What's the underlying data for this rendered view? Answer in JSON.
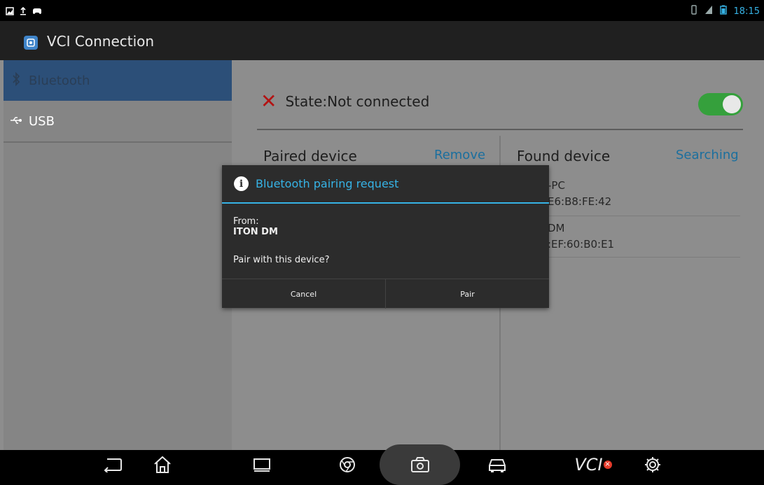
{
  "status_bar": {
    "time": "18:15",
    "left_icons": [
      "image-icon",
      "upload-icon",
      "game-controller-icon"
    ],
    "right_icons": [
      "vibrate-icon",
      "signal-icon",
      "battery-icon"
    ]
  },
  "app_bar": {
    "icon": "app-icon",
    "title": "VCI Connection"
  },
  "sidebar": {
    "items": [
      {
        "icon": "bluetooth-icon",
        "label": "Bluetooth",
        "selected": true
      },
      {
        "icon": "usb-icon",
        "label": "USB",
        "selected": false
      }
    ]
  },
  "content": {
    "state_icon": "close-icon",
    "state_text": "State:Not connected",
    "toggle_on": true,
    "paired_title": "Paired device",
    "paired_action": "Remove",
    "found_title": "Found device",
    "found_action": "Searching",
    "found_devices": [
      {
        "name": "-PC",
        "address": "E6:B8:FE:42"
      },
      {
        "name": "DM",
        "address": ":EF:60:B0:E1"
      }
    ]
  },
  "dialog": {
    "title": "Bluetooth pairing request",
    "from_label": "From:",
    "device_name": "ITON DM",
    "question": "Pair with this device?",
    "cancel_label": "Cancel",
    "pair_label": "Pair"
  },
  "nav_bar": {
    "items": [
      "back-icon",
      "home-icon",
      "recent-apps-icon",
      "browser-icon",
      "camera-icon",
      "car-icon",
      "vci-icon",
      "settings-icon"
    ],
    "vci_label": "VCI"
  },
  "colors": {
    "accent": "#36b3e6",
    "toggle_on": "#35a03c",
    "error": "#b31313"
  }
}
